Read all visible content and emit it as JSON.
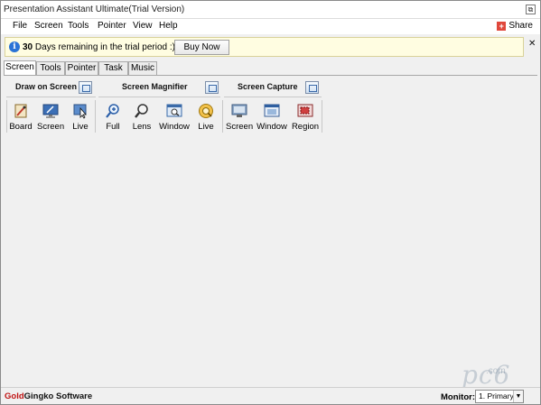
{
  "window": {
    "title": "Presentation Assistant Ultimate(Trial Version)"
  },
  "menu": {
    "items": [
      "File",
      "Screen",
      "Tools",
      "Pointer",
      "View",
      "Help"
    ],
    "share_label": "Share"
  },
  "trial": {
    "days": "30",
    "message": "Days remaining in the trial period :)",
    "buy_label": "Buy Now",
    "close_glyph": "✕"
  },
  "tabs": [
    "Screen",
    "Tools",
    "Pointer",
    "Task",
    "Music"
  ],
  "groups": {
    "draw": {
      "title": "Draw on Screen",
      "tools": [
        "Board",
        "Screen",
        "Live"
      ]
    },
    "magnifier": {
      "title": "Screen Magnifier",
      "tools": [
        "Full",
        "Lens",
        "Window",
        "Live"
      ]
    },
    "capture": {
      "title": "Screen Capture",
      "tools": [
        "Screen",
        "Window",
        "Region"
      ]
    }
  },
  "status": {
    "brand_part1": "Gold",
    "brand_part2": "Gingko Software",
    "monitor_label": "Monitor:",
    "monitor_value": "1. Primary M"
  },
  "watermark": {
    "text": "pc6",
    "sub": ".com"
  },
  "colors": {
    "accent": "#2a73d6",
    "trial_bg": "#fffde1",
    "brand_red": "#c01414"
  }
}
